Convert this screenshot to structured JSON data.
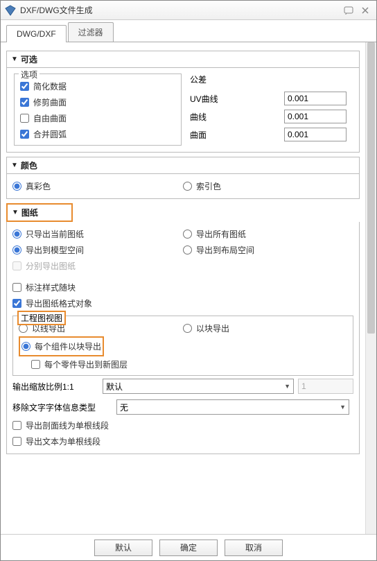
{
  "window": {
    "title": "DXF/DWG文件生成"
  },
  "tabs": {
    "active": "DWG/DXF",
    "inactive": "过滤器"
  },
  "sections": {
    "optional": {
      "title": "可选",
      "options_legend": "选项",
      "opts": {
        "simplify": "简化数据",
        "trim": "修剪曲面",
        "free": "自由曲面",
        "merge": "合并圆弧"
      },
      "tol_legend": "公差",
      "tol": {
        "uv": "UV曲线",
        "curve": "曲线",
        "surface": "曲面",
        "uv_v": "0.001",
        "curve_v": "0.001",
        "surface_v": "0.001"
      }
    },
    "color": {
      "title": "颜色",
      "truecolor": "真彩色",
      "indexed": "索引色"
    },
    "sheet": {
      "title": "图纸",
      "r1a": "只导出当前图纸",
      "r1b": "导出所有图纸",
      "r2a": "导出到模型空间",
      "r2b": "导出到布局空间",
      "sep": "分别导出图纸",
      "dimblk": "标注样式随块",
      "fmtobj": "导出图纸格式对象",
      "view_legend": "工程图视图",
      "v_line": "以线导出",
      "v_block": "以块导出",
      "v_comp": "每个组件以块导出",
      "v_layer": "每个零件导出到新图层",
      "scale_lbl": "输出缩放比例1:1",
      "scale_val": "默认",
      "scale_num": "1",
      "font_lbl": "移除文字字体信息类型",
      "font_val": "无",
      "sec_single": "导出剖面线为单根线段",
      "txt_single": "导出文本为单根线段"
    }
  },
  "footer": {
    "default": "默认",
    "ok": "确定",
    "cancel": "取消"
  }
}
